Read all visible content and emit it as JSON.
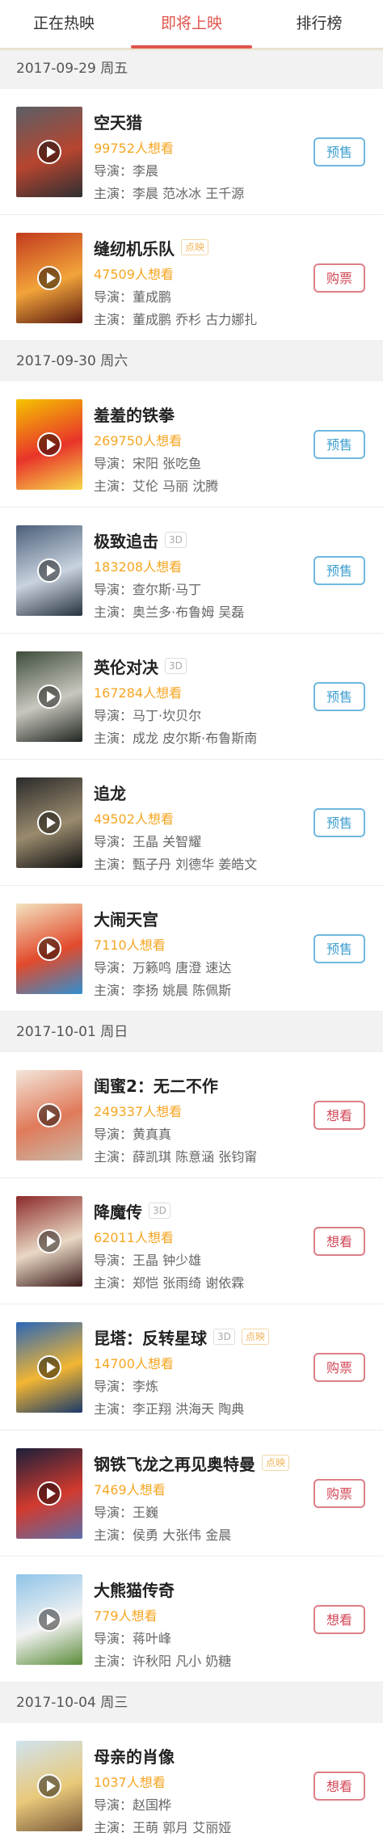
{
  "tabs": [
    {
      "label": "正在热映"
    },
    {
      "label": "即将上映"
    },
    {
      "label": "排行榜"
    }
  ],
  "director_prefix": "导演：",
  "cast_prefix": "主演：",
  "sections": [
    {
      "date": "2017-09-29 周五",
      "movies": [
        {
          "title": "空天猎",
          "tag": "",
          "want": "99752人想看",
          "director": "李晨",
          "cast": "李晨 范冰冰 王千源",
          "button": "预售",
          "button_type": "presale",
          "poster_colors": [
            "#5a5f66",
            "#b7452f",
            "#2e2f33"
          ]
        },
        {
          "title": "缝纫机乐队",
          "tag": "点映",
          "want": "47509人想看",
          "director": "董成鹏",
          "cast": "董成鹏 乔杉 古力娜扎",
          "button": "购票",
          "button_type": "buy",
          "poster_colors": [
            "#c23b1e",
            "#f2a43a",
            "#5a1a10"
          ]
        }
      ]
    },
    {
      "date": "2017-09-30 周六",
      "movies": [
        {
          "title": "羞羞的铁拳",
          "tag": "",
          "want": "269750人想看",
          "director": "宋阳 张吃鱼",
          "cast": "艾伦 马丽 沈腾",
          "button": "预售",
          "button_type": "presale",
          "poster_colors": [
            "#f5c400",
            "#e8342a",
            "#f7d94a"
          ]
        },
        {
          "title": "极致追击",
          "tag": "3D",
          "want": "183208人想看",
          "director": "查尔斯·马丁",
          "cast": "奥兰多·布鲁姆 吴磊",
          "button": "预售",
          "button_type": "presale",
          "poster_colors": [
            "#4b5f7a",
            "#c9d3df",
            "#27323f"
          ]
        },
        {
          "title": "英伦对决",
          "tag": "3D",
          "want": "167284人想看",
          "director": "马丁·坎贝尔",
          "cast": "成龙 皮尔斯·布鲁斯南",
          "button": "预售",
          "button_type": "presale",
          "poster_colors": [
            "#3d4c3a",
            "#c9c7bf",
            "#1f2620"
          ]
        },
        {
          "title": "追龙",
          "tag": "",
          "want": "49502人想看",
          "director": "王晶 关智耀",
          "cast": "甄子丹 刘德华 姜皓文",
          "button": "预售",
          "button_type": "presale",
          "poster_colors": [
            "#2b2b2b",
            "#9a8b6e",
            "#111111"
          ]
        },
        {
          "title": "大闹天宫",
          "tag": "",
          "want": "7110人想看",
          "director": "万籁鸣 唐澄 速达",
          "cast": "李扬 姚晨 陈佩斯",
          "button": "预售",
          "button_type": "presale",
          "poster_colors": [
            "#f3e3c0",
            "#e24a2c",
            "#2f8fd0"
          ]
        }
      ]
    },
    {
      "date": "2017-10-01 周日",
      "movies": [
        {
          "title": "闺蜜2：无二不作",
          "tag": "",
          "want": "249337人想看",
          "director": "黄真真",
          "cast": "薛凯琪 陈意涵 张钧甯",
          "button": "想看",
          "button_type": "want",
          "poster_colors": [
            "#f3e6da",
            "#e07a5a",
            "#c9b9a8"
          ]
        },
        {
          "title": "降魔传",
          "tag": "3D",
          "want": "62011人想看",
          "director": "王晶 钟少雄",
          "cast": "郑恺 张雨绮 谢依霖",
          "button": "想看",
          "button_type": "want",
          "poster_colors": [
            "#8c2a2a",
            "#e9d8c4",
            "#3a1a1a"
          ]
        },
        {
          "title": "昆塔：反转星球",
          "tag": "3D 点映",
          "want": "14700人想看",
          "director": "李炼",
          "cast": "李正翔 洪海天 陶典",
          "button": "购票",
          "button_type": "buy",
          "poster_colors": [
            "#2a66b8",
            "#f2b632",
            "#1b3a6b"
          ]
        },
        {
          "title": "钢铁飞龙之再见奥特曼",
          "tag": "点映",
          "want": "7469人想看",
          "director": "王巍",
          "cast": "侯勇 大张伟 金晨",
          "button": "购票",
          "button_type": "buy",
          "poster_colors": [
            "#1b1f3a",
            "#d23a2e",
            "#5c6ea8"
          ]
        },
        {
          "title": "大熊猫传奇",
          "tag": "",
          "want": "779人想看",
          "director": "蒋叶峰",
          "cast": "许秋阳 凡小 奶糖",
          "button": "想看",
          "button_type": "want",
          "poster_colors": [
            "#8fc4e8",
            "#f2f2f2",
            "#5b8c3a"
          ]
        }
      ]
    },
    {
      "date": "2017-10-04 周三",
      "movies": [
        {
          "title": "母亲的肖像",
          "tag": "",
          "want": "1037人想看",
          "director": "赵国桦",
          "cast": "王萌 郭月 艾丽娅",
          "button": "想看",
          "button_type": "want",
          "poster_colors": [
            "#cfe3ef",
            "#e9c97a",
            "#7a5a3a"
          ]
        }
      ]
    }
  ]
}
